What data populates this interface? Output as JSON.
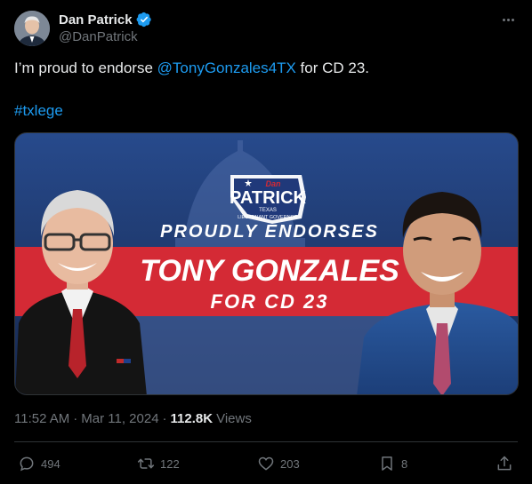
{
  "author": {
    "display_name": "Dan Patrick",
    "handle": "@DanPatrick",
    "verified_icon": "verified-badge-icon",
    "accent": "#1d9bf0"
  },
  "tweet": {
    "text_prefix": "I’m proud to endorse ",
    "mention": "@TonyGonzales4TX",
    "text_suffix": " for CD 23.",
    "hashtag": "#txlege"
  },
  "media": {
    "logo_top": "Dan",
    "logo_name": "PATRICK",
    "logo_state": "TEXAS",
    "logo_role": "LIEUTENANT GOVERNOR",
    "headline": "PROUDLY ENDORSES",
    "candidate": "TONY GONZALES",
    "district": "FOR CD 23",
    "banner_color": "#d42a35",
    "background_color": "#1c3466"
  },
  "meta": {
    "time": "11:52 AM",
    "separator": "·",
    "date": "Mar 11, 2024",
    "views_count": "112.8K",
    "views_label": "Views"
  },
  "actions": {
    "replies": "494",
    "reposts": "122",
    "likes": "203",
    "bookmarks": "8"
  }
}
